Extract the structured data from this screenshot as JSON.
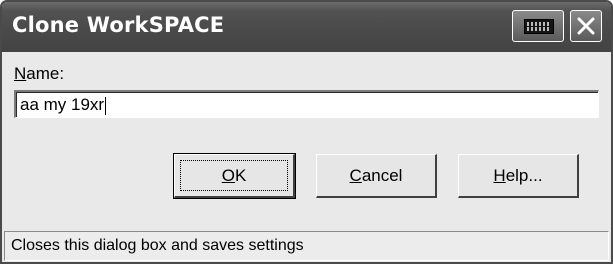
{
  "window": {
    "title": "Clone WorkSPACE"
  },
  "titlebar": {
    "buttons": [
      {
        "name": "keyboard-button",
        "icon": "keyboard-icon"
      },
      {
        "name": "close-button",
        "icon": "close-icon"
      }
    ]
  },
  "form": {
    "name_label_accel": "N",
    "name_label_rest": "ame:",
    "name_value": "aa my 19xr"
  },
  "buttons": {
    "ok_accel": "O",
    "ok_rest": "K",
    "cancel_accel": "C",
    "cancel_rest": "ancel",
    "help_accel": "H",
    "help_rest": "elp..."
  },
  "status": {
    "text": "Closes this dialog box and saves settings"
  },
  "colors": {
    "titlebar": "#4a4a4a",
    "client": "#e9e9e9",
    "title_text": "#ffffff"
  }
}
